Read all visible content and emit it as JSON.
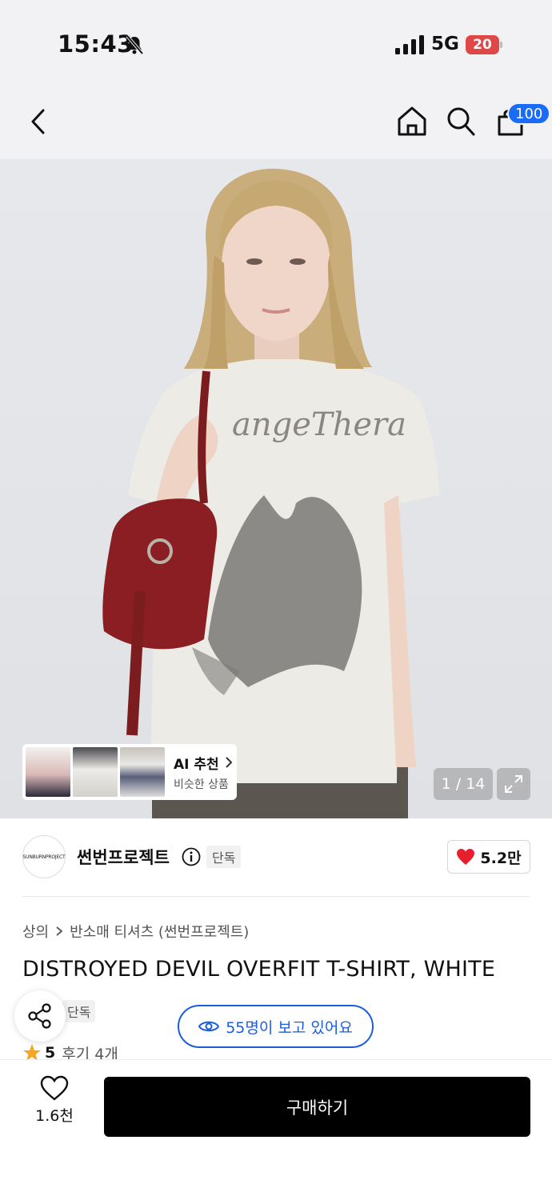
{
  "status_bar": {
    "time": "15:43",
    "network": "5G",
    "battery": "20"
  },
  "nav": {
    "cart_badge": "100"
  },
  "gallery": {
    "ai_title": "AI 추천",
    "ai_subtitle": "비슷한 상품",
    "counter": "1 / 14"
  },
  "brand": {
    "logo_text": "SUNBURNPROJECT",
    "name": "썬번프로젝트",
    "exclusive_label": "단독",
    "likes": "5.2만"
  },
  "breadcrumb": {
    "category": "상의",
    "subcategory": "반소매 티셔츠 (썬번프로젝트)"
  },
  "product": {
    "title": "DISTROYED DEVIL OVERFIT T-SHIRT, WHITE",
    "exclusive_label": "단독",
    "viewers": "55명이 보고 있어요",
    "rating": "5",
    "review_label": "후기 4개"
  },
  "bottom": {
    "wish_count": "1.6천",
    "buy_label": "구매하기"
  },
  "colors": {
    "accent_blue": "#1a5de0",
    "badge_blue": "#1a6cf6",
    "heart_red": "#e8202e",
    "star_orange": "#f5a623"
  }
}
